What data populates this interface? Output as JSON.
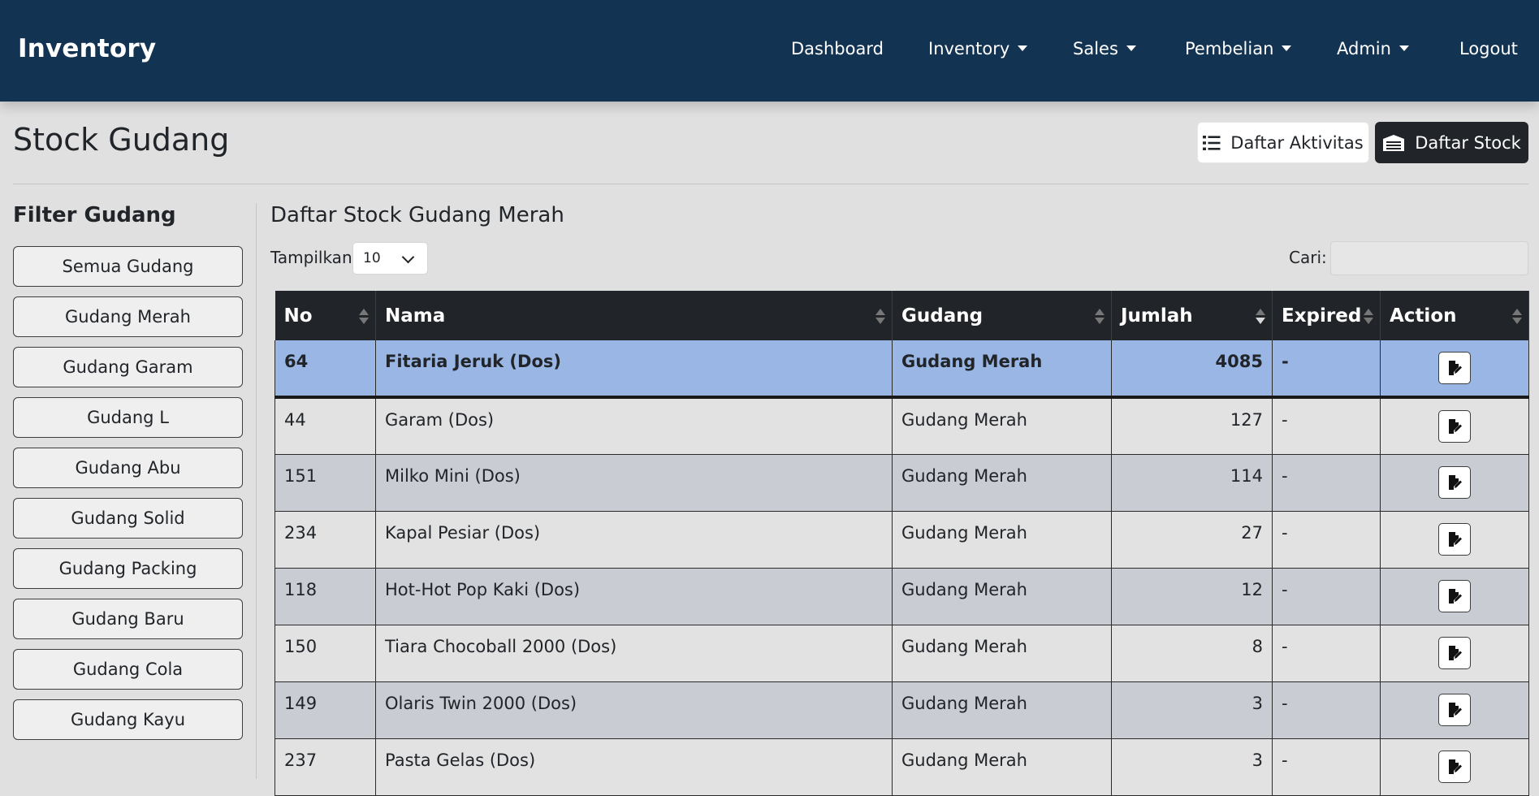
{
  "navbar": {
    "brand": "Inventory",
    "items": [
      {
        "label": "Dashboard",
        "dropdown": false
      },
      {
        "label": "Inventory",
        "dropdown": true
      },
      {
        "label": "Sales",
        "dropdown": true
      },
      {
        "label": "Pembelian",
        "dropdown": true
      },
      {
        "label": "Admin",
        "dropdown": true
      },
      {
        "label": "Logout",
        "dropdown": false
      }
    ]
  },
  "header": {
    "title": "Stock Gudang",
    "btn_aktivitas": "Daftar Aktivitas",
    "btn_stock": "Daftar Stock"
  },
  "sidebar": {
    "title": "Filter Gudang",
    "items": [
      "Semua Gudang",
      "Gudang Merah",
      "Gudang Garam",
      "Gudang L",
      "Gudang Abu",
      "Gudang Solid",
      "Gudang Packing",
      "Gudang Baru",
      "Gudang Cola",
      "Gudang Kayu"
    ]
  },
  "main": {
    "title": "Daftar Stock Gudang Merah",
    "show_label": "Tampilkan",
    "show_value": "10",
    "search_label": "Cari:",
    "search_value": ""
  },
  "table": {
    "columns": [
      "No",
      "Nama",
      "Gudang",
      "Jumlah",
      "Expired",
      "Action"
    ],
    "rows": [
      {
        "no": "64",
        "nama": "Fitaria Jeruk (Dos)",
        "gudang": "Gudang Merah",
        "jumlah": "4085",
        "expired": "-"
      },
      {
        "no": "44",
        "nama": "Garam (Dos)",
        "gudang": "Gudang Merah",
        "jumlah": "127",
        "expired": "-"
      },
      {
        "no": "151",
        "nama": "Milko Mini (Dos)",
        "gudang": "Gudang Merah",
        "jumlah": "114",
        "expired": "-"
      },
      {
        "no": "234",
        "nama": "Kapal Pesiar (Dos)",
        "gudang": "Gudang Merah",
        "jumlah": "27",
        "expired": "-"
      },
      {
        "no": "118",
        "nama": "Hot-Hot Pop Kaki (Dos)",
        "gudang": "Gudang Merah",
        "jumlah": "12",
        "expired": "-"
      },
      {
        "no": "150",
        "nama": "Tiara Chocoball 2000 (Dos)",
        "gudang": "Gudang Merah",
        "jumlah": "8",
        "expired": "-"
      },
      {
        "no": "149",
        "nama": "Olaris Twin 2000 (Dos)",
        "gudang": "Gudang Merah",
        "jumlah": "3",
        "expired": "-"
      },
      {
        "no": "237",
        "nama": "Pasta Gelas (Dos)",
        "gudang": "Gudang Merah",
        "jumlah": "3",
        "expired": "-"
      }
    ]
  }
}
